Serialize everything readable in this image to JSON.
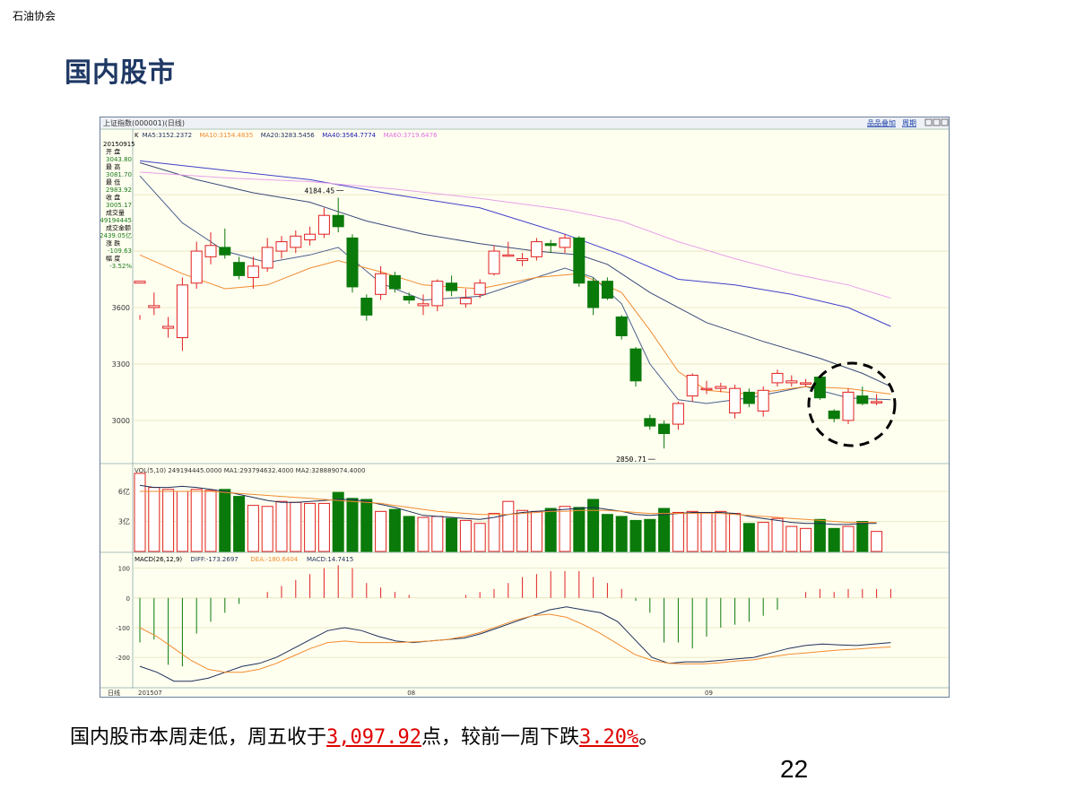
{
  "header": {
    "org": "石油协会"
  },
  "title": "国内股市",
  "caption": {
    "pre": "国内股市本周走低，周五收于",
    "close_value": "3,097.92",
    "mid": "点，较前一周下跌",
    "change": "3.20%",
    "post": "。"
  },
  "page_number": "22",
  "chart_data": [
    {
      "type": "candlestick",
      "title": "上证指数(000001)(日线)",
      "toolbar": {
        "overlay": "品品叠加",
        "period": "周期"
      },
      "indicator_labels": [
        {
          "text": "K",
          "color": "#000000"
        },
        {
          "text": "MA5:3152.2372",
          "color": "#1f2f5a"
        },
        {
          "text": "MA10:3154.4835",
          "color": "#f28b30"
        },
        {
          "text": "MA20:3283.5456",
          "color": "#1f2f5a"
        },
        {
          "text": "MA40:3564.7774",
          "color": "#2020b0"
        },
        {
          "text": "MA60:3719.6476",
          "color": "#e070e0"
        }
      ],
      "info_panel": [
        {
          "label": "20150915",
          "value": ""
        },
        {
          "label": "开 盘",
          "value": "3043.80"
        },
        {
          "label": "最 高",
          "value": "3081.70"
        },
        {
          "label": "最 低",
          "value": "2983.92"
        },
        {
          "label": "收 盘",
          "value": "3005.17"
        },
        {
          "label": "成交量",
          "value": "249194445"
        },
        {
          "label": "成交金额",
          "value": "2439.05亿"
        },
        {
          "label": "涨 跌",
          "value": "-109.63"
        },
        {
          "label": "幅 度",
          "value": "-3.52%"
        }
      ],
      "y_ticks": [
        3000,
        3300,
        3600
      ],
      "ylim": [
        2780,
        4420
      ],
      "annotations": [
        {
          "text": "4184.45",
          "index": 14,
          "value": 4184.45
        },
        {
          "text": "2850.71",
          "index": 36,
          "value": 2850.71
        }
      ],
      "candles": [
        [
          3730,
          3740,
          3560,
          3535
        ],
        [
          3600,
          3610,
          3680,
          3560
        ],
        [
          3490,
          3500,
          3550,
          3440
        ],
        [
          3440,
          3720,
          3760,
          3370
        ],
        [
          3730,
          3900,
          3950,
          3700
        ],
        [
          3870,
          3930,
          4000,
          3830
        ],
        [
          3920,
          3880,
          4020,
          3860
        ],
        [
          3840,
          3770,
          3870,
          3750
        ],
        [
          3760,
          3820,
          3870,
          3700
        ],
        [
          3810,
          3920,
          3970,
          3790
        ],
        [
          3900,
          3950,
          3980,
          3860
        ],
        [
          3920,
          3980,
          4010,
          3890
        ],
        [
          3960,
          3990,
          4030,
          3930
        ],
        [
          3990,
          4090,
          4130,
          3970
        ],
        [
          4090,
          4030,
          4184.45,
          4000
        ],
        [
          3970,
          3710,
          3990,
          3680
        ],
        [
          3650,
          3560,
          3670,
          3530
        ],
        [
          3670,
          3780,
          3820,
          3640
        ],
        [
          3770,
          3700,
          3790,
          3680
        ],
        [
          3660,
          3640,
          3680,
          3620
        ],
        [
          3610,
          3620,
          3670,
          3560
        ],
        [
          3610,
          3740,
          3750,
          3580
        ],
        [
          3730,
          3690,
          3770,
          3660
        ],
        [
          3620,
          3650,
          3700,
          3600
        ],
        [
          3670,
          3730,
          3750,
          3650
        ],
        [
          3780,
          3900,
          3930,
          3770
        ],
        [
          3880,
          3880,
          3950,
          3870
        ],
        [
          3850,
          3860,
          3890,
          3820
        ],
        [
          3870,
          3950,
          3970,
          3850
        ],
        [
          3940,
          3930,
          3960,
          3890
        ],
        [
          3920,
          3970,
          3990,
          3890
        ],
        [
          3970,
          3730,
          3980,
          3710
        ],
        [
          3740,
          3600,
          3760,
          3560
        ],
        [
          3740,
          3650,
          3760,
          3640
        ],
        [
          3550,
          3450,
          3560,
          3430
        ],
        [
          3380,
          3210,
          3390,
          3180
        ],
        [
          3010,
          2970,
          3030,
          2950
        ],
        [
          2980,
          2930,
          3000,
          2850.71
        ],
        [
          2980,
          3090,
          3100,
          2950
        ],
        [
          3130,
          3240,
          3250,
          3100
        ],
        [
          3170,
          3170,
          3210,
          3140
        ],
        [
          3170,
          3180,
          3200,
          3150
        ],
        [
          3040,
          3170,
          3190,
          3010
        ],
        [
          3150,
          3090,
          3170,
          3070
        ],
        [
          3050,
          3160,
          3180,
          3020
        ],
        [
          3200,
          3250,
          3270,
          3180
        ],
        [
          3200,
          3210,
          3240,
          3180
        ],
        [
          3200,
          3200,
          3220,
          3180
        ],
        [
          3230,
          3120,
          3240,
          3110
        ],
        [
          3050,
          3010,
          3060,
          2990
        ],
        [
          3000,
          3150,
          3170,
          2980
        ],
        [
          3130,
          3090,
          3180,
          3080
        ],
        [
          3100,
          3100,
          3140,
          3080
        ]
      ],
      "ma_lines": [
        {
          "name": "MA5",
          "color": "#4a5f8c",
          "points": [
            [
              0,
              4300
            ],
            [
              3,
              4050
            ],
            [
              6,
              3900
            ],
            [
              9,
              3840
            ],
            [
              12,
              3880
            ],
            [
              14,
              3920
            ],
            [
              17,
              3730
            ],
            [
              20,
              3640
            ],
            [
              24,
              3660
            ],
            [
              28,
              3760
            ],
            [
              30,
              3810
            ],
            [
              32,
              3760
            ],
            [
              34,
              3620
            ],
            [
              36,
              3300
            ],
            [
              38,
              3110
            ],
            [
              40,
              3090
            ],
            [
              43,
              3120
            ],
            [
              47,
              3180
            ],
            [
              50,
              3120
            ],
            [
              53,
              3110
            ]
          ]
        },
        {
          "name": "MA10",
          "color": "#f28b30",
          "points": [
            [
              0,
              3880
            ],
            [
              3,
              3780
            ],
            [
              6,
              3700
            ],
            [
              9,
              3720
            ],
            [
              12,
              3810
            ],
            [
              14,
              3850
            ],
            [
              17,
              3790
            ],
            [
              20,
              3720
            ],
            [
              24,
              3700
            ],
            [
              28,
              3760
            ],
            [
              31,
              3780
            ],
            [
              34,
              3680
            ],
            [
              36,
              3480
            ],
            [
              38,
              3260
            ],
            [
              40,
              3160
            ],
            [
              43,
              3140
            ],
            [
              47,
              3180
            ],
            [
              50,
              3170
            ],
            [
              53,
              3140
            ]
          ]
        },
        {
          "name": "MA20",
          "color": "#3a4a78",
          "points": [
            [
              0,
              4370
            ],
            [
              4,
              4280
            ],
            [
              8,
              4210
            ],
            [
              12,
              4160
            ],
            [
              16,
              4060
            ],
            [
              20,
              3990
            ],
            [
              24,
              3940
            ],
            [
              28,
              3900
            ],
            [
              31,
              3880
            ],
            [
              33,
              3830
            ],
            [
              36,
              3680
            ],
            [
              40,
              3520
            ],
            [
              44,
              3420
            ],
            [
              48,
              3330
            ],
            [
              51,
              3250
            ],
            [
              53,
              3180
            ]
          ]
        },
        {
          "name": "MA40",
          "color": "#4040c8",
          "points": [
            [
              0,
              4380
            ],
            [
              6,
              4330
            ],
            [
              12,
              4280
            ],
            [
              18,
              4200
            ],
            [
              24,
              4130
            ],
            [
              30,
              3990
            ],
            [
              34,
              3880
            ],
            [
              38,
              3750
            ],
            [
              42,
              3720
            ],
            [
              46,
              3670
            ],
            [
              50,
              3600
            ],
            [
              53,
              3500
            ]
          ]
        },
        {
          "name": "MA60",
          "color": "#e8a0e8",
          "points": [
            [
              0,
              4320
            ],
            [
              6,
              4290
            ],
            [
              12,
              4270
            ],
            [
              18,
              4230
            ],
            [
              24,
              4180
            ],
            [
              30,
              4120
            ],
            [
              34,
              4060
            ],
            [
              38,
              3950
            ],
            [
              42,
              3860
            ],
            [
              46,
              3780
            ],
            [
              50,
              3720
            ],
            [
              53,
              3650
            ]
          ]
        }
      ]
    },
    {
      "type": "bar",
      "title": "VOL(5,10) 249194445.0000 MA1:293794632.4000 MA2:328889074.4000",
      "y_ticks": [
        "3亿",
        "6亿"
      ],
      "values_yi": [
        7.8,
        6.4,
        6.2,
        6.0,
        6.2,
        6.1,
        6.2,
        5.5,
        4.6,
        4.5,
        5.0,
        4.9,
        4.8,
        4.8,
        5.9,
        5.3,
        5.2,
        4.0,
        4.2,
        3.5,
        3.4,
        3.5,
        3.3,
        3.1,
        2.8,
        3.8,
        5.0,
        4.1,
        4.0,
        4.3,
        4.5,
        4.4,
        5.2,
        3.7,
        3.5,
        3.1,
        3.2,
        4.3,
        3.9,
        4.0,
        3.9,
        4.0,
        3.8,
        2.8,
        2.9,
        3.3,
        2.5,
        2.3,
        3.2,
        2.3,
        2.5,
        3.0,
        2.0
      ],
      "ma_lines": [
        {
          "name": "MA1",
          "color": "#1f2f5a",
          "values": [
            6.6,
            6.4,
            6.4,
            6.5,
            6.4,
            6.2,
            6.0,
            5.7,
            5.4,
            5.1,
            4.9,
            4.9,
            5.0,
            5.1,
            5.2,
            5.2,
            5.0,
            4.7,
            4.4,
            4.0,
            3.6,
            3.5,
            3.4,
            3.3,
            3.2,
            3.4,
            3.7,
            3.9,
            4.0,
            4.1,
            4.2,
            4.3,
            4.4,
            4.2,
            4.0,
            3.7,
            3.6,
            3.7,
            3.8,
            3.9,
            3.9,
            3.9,
            3.8,
            3.5,
            3.3,
            3.1,
            2.9,
            2.8,
            2.8,
            2.7,
            2.7,
            2.8,
            2.8
          ]
        },
        {
          "name": "MA2",
          "color": "#f28b30",
          "values": [
            6.0,
            6.0,
            6.0,
            6.0,
            6.0,
            6.0,
            5.9,
            5.8,
            5.7,
            5.6,
            5.5,
            5.4,
            5.3,
            5.2,
            5.1,
            5.0,
            4.9,
            4.8,
            4.6,
            4.4,
            4.2,
            4.0,
            3.9,
            3.8,
            3.7,
            3.7,
            3.7,
            3.8,
            3.9,
            4.0,
            4.0,
            4.1,
            4.1,
            4.1,
            4.0,
            3.9,
            3.8,
            3.8,
            3.8,
            3.8,
            3.8,
            3.8,
            3.7,
            3.6,
            3.5,
            3.4,
            3.3,
            3.2,
            3.1,
            3.0,
            2.9,
            2.9,
            2.9
          ]
        }
      ]
    },
    {
      "type": "line",
      "title": "MACD(26,12,9) DIFF:-173.2697 DEA:-180.6404 MACD:14.7415",
      "labels": [
        {
          "text": "MACD(26,12,9)",
          "color": "#000000"
        },
        {
          "text": "DIFF:-173.2697",
          "color": "#1f2f5a"
        },
        {
          "text": "DEA:-180.6404",
          "color": "#f28b30"
        },
        {
          "text": "MACD:14.7415",
          "color": "#1f2f5a"
        }
      ],
      "y_ticks": [
        100,
        0,
        -100,
        -200
      ],
      "x_labels": [
        {
          "text": "日线",
          "index": -1
        },
        {
          "text": "201507",
          "index": 0
        },
        {
          "text": "08",
          "index": 19
        },
        {
          "text": "09",
          "index": 40
        }
      ],
      "macd_hist": [
        -150,
        -140,
        -225,
        -230,
        -120,
        -80,
        -50,
        -20,
        0,
        20,
        40,
        60,
        80,
        100,
        110,
        100,
        50,
        35,
        20,
        10,
        0,
        0,
        0,
        10,
        20,
        30,
        50,
        70,
        80,
        90,
        90,
        90,
        70,
        50,
        30,
        -10,
        -50,
        -150,
        -150,
        -170,
        -130,
        -100,
        -90,
        -80,
        -60,
        -40,
        0,
        20,
        30,
        20,
        30,
        30,
        30,
        30
      ],
      "diff": [
        -230,
        -250,
        -280,
        -280,
        -270,
        -250,
        -230,
        -220,
        -200,
        -170,
        -140,
        -110,
        -100,
        -110,
        -130,
        -145,
        -150,
        -145,
        -140,
        -135,
        -120,
        -100,
        -80,
        -60,
        -40,
        -30,
        -40,
        -50,
        -80,
        -140,
        -200,
        -220,
        -215,
        -215,
        -210,
        -205,
        -200,
        -185,
        -170,
        -160,
        -155,
        -158,
        -160,
        -155,
        -150
      ],
      "dea": [
        -100,
        -130,
        -170,
        -210,
        -240,
        -250,
        -250,
        -240,
        -220,
        -195,
        -170,
        -150,
        -145,
        -150,
        -150,
        -150,
        -148,
        -145,
        -140,
        -130,
        -115,
        -95,
        -75,
        -60,
        -55,
        -65,
        -90,
        -120,
        -155,
        -190,
        -210,
        -220,
        -222,
        -222,
        -218,
        -212,
        -208,
        -198,
        -190,
        -185,
        -180,
        -175,
        -172,
        -168,
        -165
      ],
      "ylim": [
        -290,
        120
      ]
    }
  ]
}
